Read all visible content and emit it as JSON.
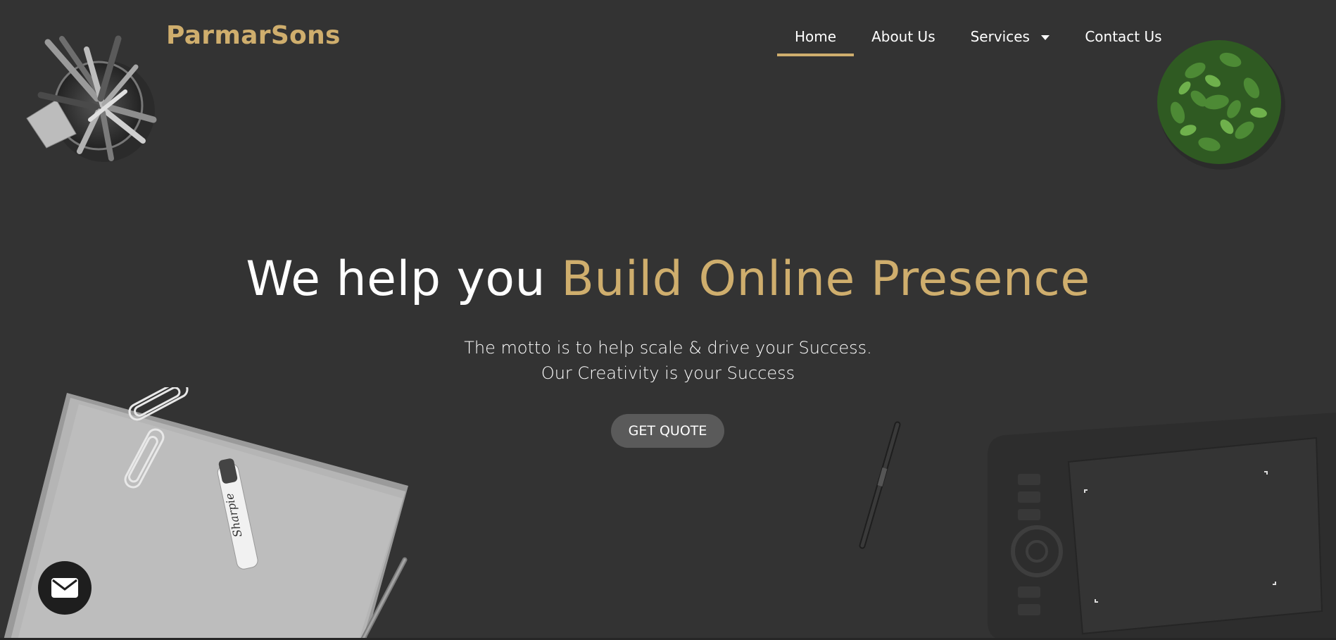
{
  "brand": {
    "name": "ParmarSons",
    "color": "#cfae6d"
  },
  "nav": {
    "items": [
      {
        "label": "Home",
        "active": true
      },
      {
        "label": "About Us",
        "active": false
      },
      {
        "label": "Services",
        "active": false,
        "has_dropdown": true
      },
      {
        "label": "Contact Us",
        "active": false
      }
    ]
  },
  "hero": {
    "title_plain": "We help you ",
    "title_accent": "Build Online Presence",
    "subtitle_line1": "The motto is to help scale & drive your Success.",
    "subtitle_line2": "Our Creativity is your Success",
    "cta_label": "GET QUOTE"
  },
  "floating": {
    "icon": "envelope-icon"
  },
  "colors": {
    "background": "#333333",
    "accent": "#cfae6d",
    "cta_bg": "#5a5a5a",
    "text": "#ffffff"
  }
}
